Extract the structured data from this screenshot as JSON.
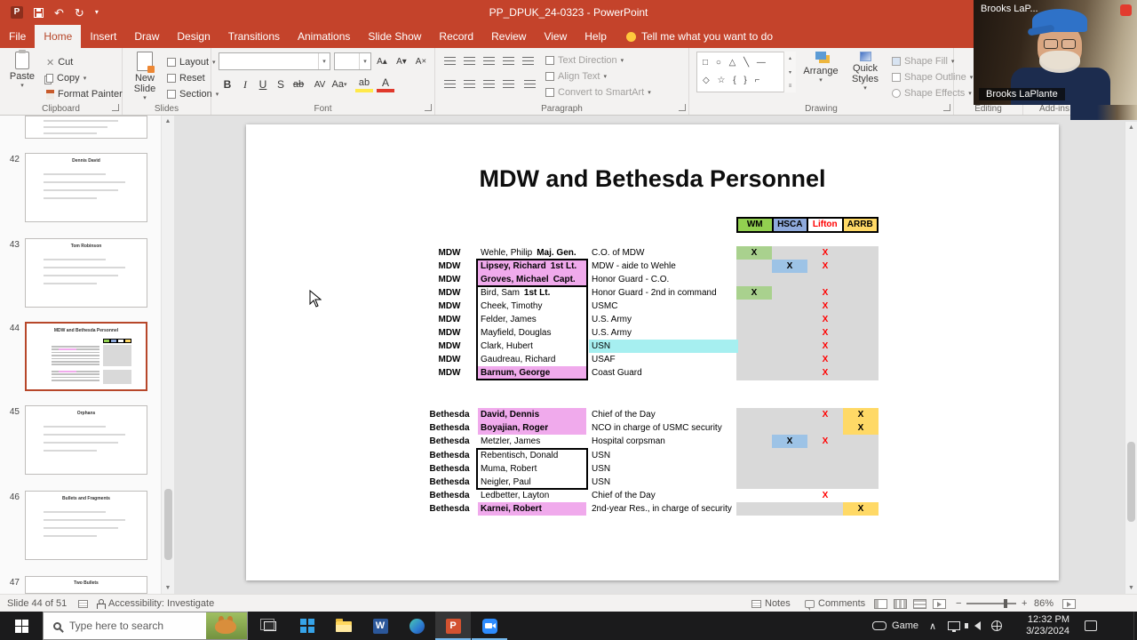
{
  "titlebar": {
    "title": "PP_DPUK_24-0323 - PowerPoint",
    "overlay_title": "Brooks LaP..."
  },
  "colors": {
    "titlebar_red": "#C4432B",
    "selected_thumb_border": "#B7472A",
    "pink_highlight": "#F0AAEC",
    "cyan_highlight": "#A6EFF0",
    "grid_gray": "#D9D9D9"
  },
  "ribbon": {
    "tabs": [
      "File",
      "Home",
      "Insert",
      "Draw",
      "Design",
      "Transitions",
      "Animations",
      "Slide Show",
      "Record",
      "Review",
      "View",
      "Help"
    ],
    "selected_tab": "Home",
    "tell_me": "Tell me what you want to do",
    "groups": {
      "clipboard": {
        "label": "Clipboard",
        "paste": "Paste",
        "cut": "Cut",
        "copy": "Copy",
        "format_painter": "Format Painter"
      },
      "slides": {
        "label": "Slides",
        "new_slide": "New Slide",
        "layout": "Layout",
        "reset": "Reset",
        "section": "Section"
      },
      "font": {
        "label": "Font"
      },
      "paragraph": {
        "label": "Paragraph",
        "text_direction": "Text Direction",
        "align_text": "Align Text",
        "convert_smartart": "Convert to SmartArt"
      },
      "drawing": {
        "label": "Drawing",
        "arrange": "Arrange",
        "quick_styles": "Quick Styles",
        "shape_fill": "Shape Fill",
        "shape_outline": "Shape Outline",
        "shape_effects": "Shape Effects"
      },
      "editing": {
        "label": "Editing"
      },
      "addins": {
        "label": "Add-ins"
      }
    }
  },
  "thumb_panel": {
    "slides": [
      {
        "num": "",
        "title": "",
        "selected": false
      },
      {
        "num": "42",
        "title": "Dennis David",
        "selected": false
      },
      {
        "num": "43",
        "title": "Tom Robinson",
        "selected": false
      },
      {
        "num": "44",
        "title": "MDW and Bethesda Personnel",
        "selected": true,
        "mini": "personnel"
      },
      {
        "num": "45",
        "title": "Orphans",
        "selected": false
      },
      {
        "num": "46",
        "title": "Bullets and Fragments",
        "selected": false
      },
      {
        "num": "47",
        "title": "Two Bullets",
        "selected": false
      }
    ]
  },
  "slide": {
    "title": "MDW and Bethesda Personnel",
    "columns": [
      {
        "label": "WM",
        "bg": "#92D050",
        "fg": "#000000"
      },
      {
        "label": "HSCA",
        "bg": "#8FAADC",
        "fg": "#000000"
      },
      {
        "label": "Lifton",
        "bg": "#FFFFFF",
        "fg": "#FF0000"
      },
      {
        "label": "ARRB",
        "bg": "#FFD966",
        "fg": "#000000"
      }
    ],
    "mark_styles": {
      "green": {
        "bg": "#A9D18E",
        "fg": "#000000"
      },
      "blue": {
        "bg": "#9DC3E6",
        "fg": "#000000"
      },
      "red": {
        "bg": "",
        "fg": "#FF0000"
      },
      "yellow": {
        "bg": "#FFD966",
        "fg": "#000000"
      }
    },
    "mdw_rows": [
      {
        "org": "MDW",
        "name": "Wehle, Philip",
        "rank": "Maj. Gen.",
        "desc": "C.O. of MDW",
        "pink": false,
        "cyan": false,
        "marks": {
          "0": "green",
          "2": "red"
        }
      },
      {
        "org": "MDW",
        "name": "Lipsey, Richard",
        "rank": "1st Lt.",
        "desc": "MDW - aide to Wehle",
        "pink": true,
        "cyan": false,
        "marks": {
          "1": "blue",
          "2": "red"
        }
      },
      {
        "org": "MDW",
        "name": "Groves, Michael",
        "rank": "Capt.",
        "desc": "Honor Guard - C.O.",
        "pink": true,
        "cyan": false,
        "marks": {}
      },
      {
        "org": "MDW",
        "name": "Bird, Sam",
        "rank": "1st Lt.",
        "desc": "Honor Guard - 2nd in command",
        "pink": false,
        "cyan": false,
        "marks": {
          "0": "green",
          "2": "red"
        }
      },
      {
        "org": "MDW",
        "name": "Cheek, Timothy",
        "rank": "",
        "desc": "USMC",
        "pink": false,
        "cyan": false,
        "marks": {
          "2": "red"
        }
      },
      {
        "org": "MDW",
        "name": "Felder, James",
        "rank": "",
        "desc": "U.S. Army",
        "pink": false,
        "cyan": false,
        "marks": {
          "2": "red"
        }
      },
      {
        "org": "MDW",
        "name": "Mayfield, Douglas",
        "rank": "",
        "desc": "U.S. Army",
        "pink": false,
        "cyan": false,
        "marks": {
          "2": "red"
        }
      },
      {
        "org": "MDW",
        "name": "Clark, Hubert",
        "rank": "",
        "desc": "USN",
        "pink": false,
        "cyan": true,
        "marks": {
          "2": "red"
        }
      },
      {
        "org": "MDW",
        "name": "Gaudreau, Richard",
        "rank": "",
        "desc": "USAF",
        "pink": false,
        "cyan": false,
        "marks": {
          "2": "red"
        }
      },
      {
        "org": "MDW",
        "name": "Barnum, George",
        "rank": "",
        "desc": "Coast Guard",
        "pink": true,
        "cyan": false,
        "marks": {
          "2": "red"
        }
      }
    ],
    "bethesda_rows": [
      {
        "org": "Bethesda",
        "name": "David, Dennis",
        "rank": "",
        "desc": "Chief of the Day",
        "pink": true,
        "cyan": false,
        "marks": {
          "2": "red",
          "3": "yellow"
        }
      },
      {
        "org": "Bethesda",
        "name": "Boyajian, Roger",
        "rank": "",
        "desc": "NCO in charge of USMC security",
        "pink": true,
        "cyan": false,
        "marks": {
          "3": "yellow"
        }
      },
      {
        "org": "Bethesda",
        "name": "Metzler, James",
        "rank": "",
        "desc": "Hospital corpsman",
        "pink": false,
        "cyan": false,
        "marks": {
          "1": "blue",
          "2": "red"
        }
      },
      {
        "org": "Bethesda",
        "name": "Rebentisch, Donald",
        "rank": "",
        "desc": "USN",
        "pink": false,
        "cyan": false,
        "marks": {}
      },
      {
        "org": "Bethesda",
        "name": "Muma, Robert",
        "rank": "",
        "desc": "USN",
        "pink": false,
        "cyan": false,
        "marks": {}
      },
      {
        "org": "Bethesda",
        "name": "Neigler, Paul",
        "rank": "",
        "desc": "USN",
        "pink": false,
        "cyan": false,
        "marks": {}
      },
      {
        "org": "Bethesda",
        "name": "Ledbetter, Layton",
        "rank": "",
        "desc": "Chief of the Day",
        "pink": false,
        "cyan": false,
        "marks": {
          "2": "red"
        }
      },
      {
        "org": "Bethesda",
        "name": "Karnei, Robert",
        "rank": "",
        "desc": "2nd-year Res., in charge of security",
        "pink": true,
        "cyan": false,
        "marks": {
          "3": "yellow"
        }
      }
    ]
  },
  "statusbar": {
    "slide_info": "Slide 44 of 51",
    "accessibility": "Accessibility: Investigate",
    "notes": "Notes",
    "comments": "Comments",
    "zoom_percent": "86%"
  },
  "taskbar": {
    "search_placeholder": "Type here to search",
    "tray_label": "Game",
    "time": "12:32 PM",
    "date": "3/23/2024"
  },
  "webcam": {
    "name": "Brooks LaPlante"
  }
}
